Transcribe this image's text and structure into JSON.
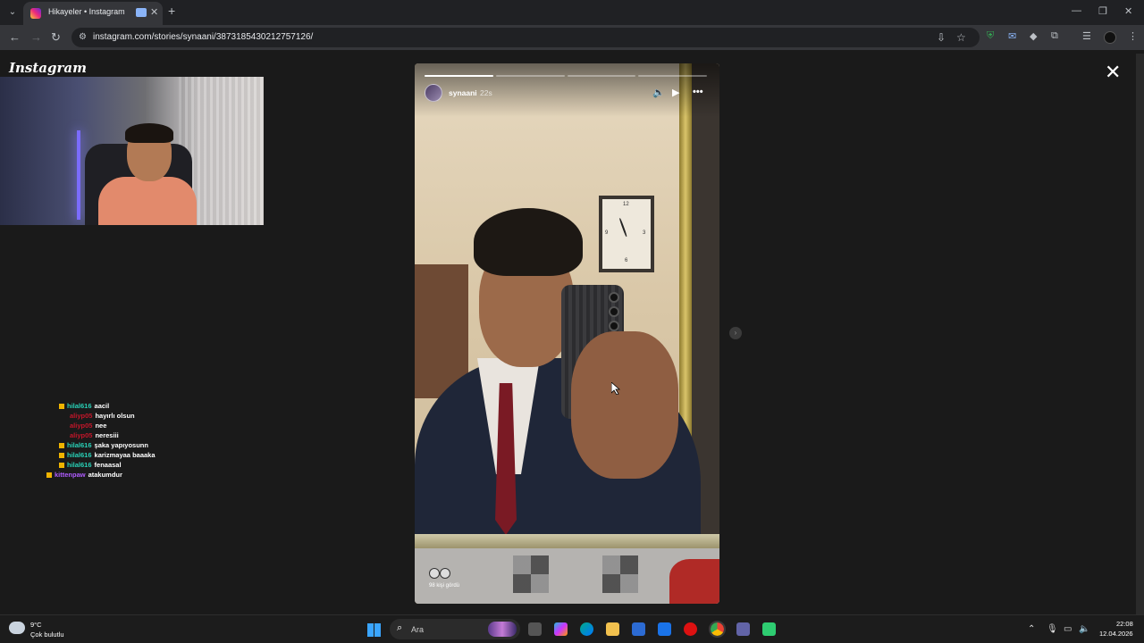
{
  "browser": {
    "tab_title": "Hikayeler • Instagram",
    "tab_close": "✕",
    "new_tab": "+",
    "url": "instagram.com/stories/synaani/3873185430212757126/",
    "window_controls": [
      "—",
      "❐",
      "✕"
    ]
  },
  "instagram": {
    "logo": "Instagram",
    "close_glyph": "✕"
  },
  "story": {
    "username": "synaani",
    "time_ago": "22s",
    "progress_segments": [
      {
        "fill": 1.0
      },
      {
        "fill": 0.0
      },
      {
        "fill": 0.0
      },
      {
        "fill": 0.0
      }
    ],
    "viewers_text": "98 kişi gördü",
    "next_glyph": "›",
    "clock_numbers": [
      "12",
      "3",
      "6",
      "9"
    ]
  },
  "chat": [
    {
      "user": "hilal616",
      "msg": "aacil",
      "color": "#29d2b8",
      "badge": true
    },
    {
      "user": "aliyp05",
      "msg": "hayırlı olsun",
      "color": "#c4162a",
      "badge": false
    },
    {
      "user": "aliyp05",
      "msg": "nee",
      "color": "#c4162a",
      "badge": false
    },
    {
      "user": "aliyp05",
      "msg": "neresiii",
      "color": "#c4162a",
      "badge": false
    },
    {
      "user": "hilal616",
      "msg": "şaka yapıyosunn",
      "color": "#29d2b8",
      "badge": true
    },
    {
      "user": "hilal616",
      "msg": "karizmayaa baaaka",
      "color": "#29d2b8",
      "badge": true
    },
    {
      "user": "hilal616",
      "msg": "fenaasal",
      "color": "#29d2b8",
      "badge": true
    },
    {
      "user": "kittenpaw",
      "msg": "atakumdur",
      "color": "#b05cff",
      "badge": true
    }
  ],
  "taskbar": {
    "temp": "9°C",
    "weather": "Çok bulutlu",
    "search_placeholder": "Ara",
    "time": "22:08",
    "date": "12.04.2026"
  }
}
